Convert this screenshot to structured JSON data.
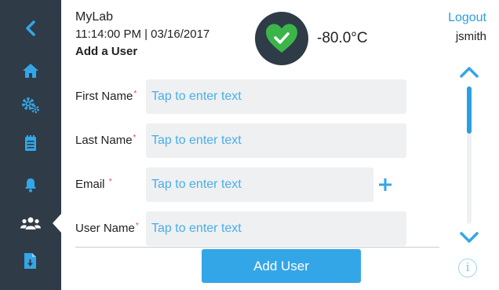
{
  "header": {
    "app_name": "MyLab",
    "datetime": "11:14:00 PM | 03/16/2017",
    "page_title": "Add a User",
    "temperature": "-80.0°C",
    "status_icon": "heart-check-icon",
    "status_color": "#3bb54a",
    "logout_label": "Logout",
    "username": "jsmith"
  },
  "sidebar": {
    "items": [
      {
        "name": "back",
        "icon": "chevron-left-icon"
      },
      {
        "name": "home",
        "icon": "home-icon"
      },
      {
        "name": "settings",
        "icon": "gears-icon"
      },
      {
        "name": "log",
        "icon": "clipboard-icon"
      },
      {
        "name": "alarms",
        "icon": "bell-icon"
      },
      {
        "name": "users",
        "icon": "users-icon",
        "active": true
      },
      {
        "name": "export",
        "icon": "file-download-icon"
      }
    ],
    "icon_color": "#33a6e7",
    "active_icon_color": "#ffffff",
    "background": "#2f3b47"
  },
  "form": {
    "fields": [
      {
        "label": "First Name",
        "required_mark": "*",
        "placeholder": "Tap to enter text",
        "value": ""
      },
      {
        "label": "Last Name",
        "required_mark": "*",
        "placeholder": "Tap to enter text",
        "value": ""
      },
      {
        "label": "Email ",
        "required_mark": "*",
        "placeholder": "Tap to enter text",
        "value": ""
      },
      {
        "label": "User Name",
        "required_mark": "*",
        "placeholder": "Tap to enter text",
        "value": ""
      }
    ],
    "submit_label": "Add User"
  },
  "scroll": {
    "info_label": "i"
  },
  "colors": {
    "accent": "#33a6e7",
    "required": "#e04848",
    "field_background": "#eef0f2"
  }
}
